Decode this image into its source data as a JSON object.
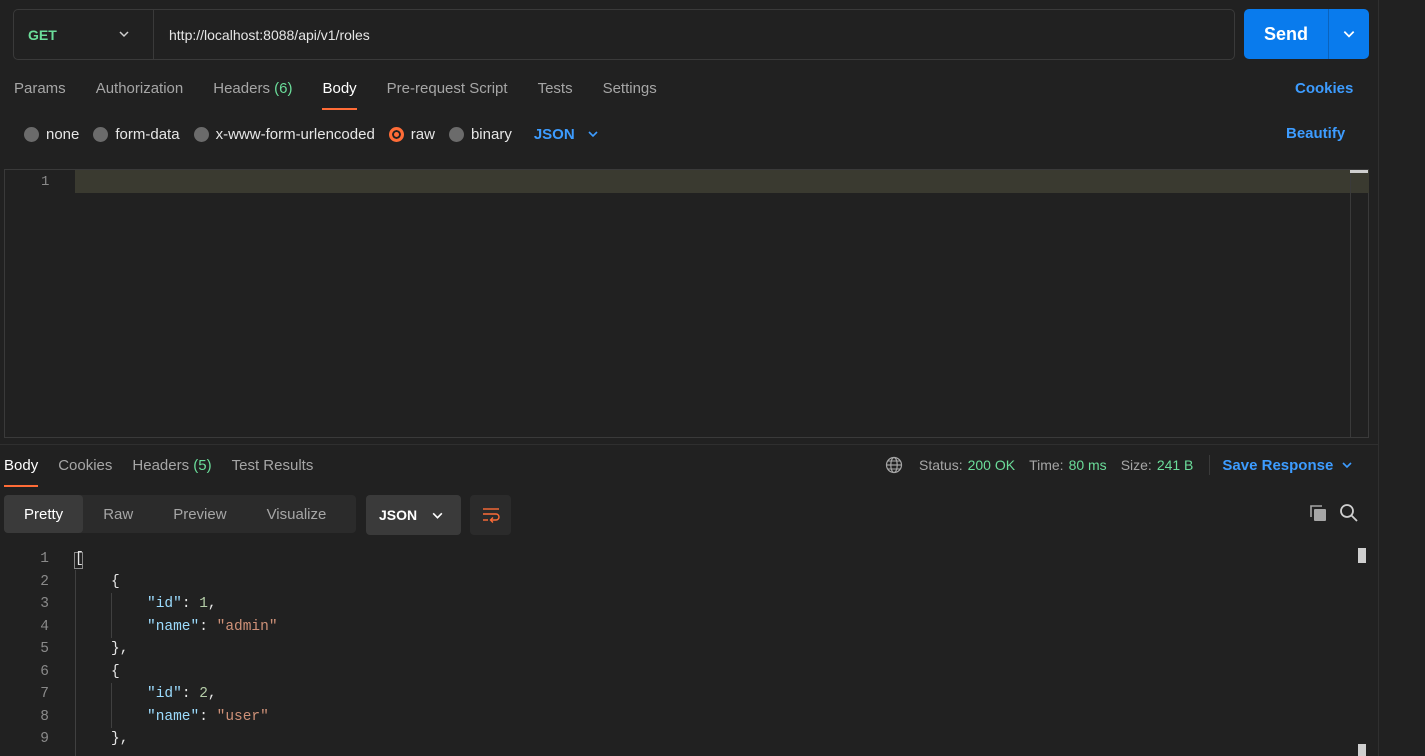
{
  "request": {
    "method": "GET",
    "url": "http://localhost:8088/api/v1/roles",
    "send_label": "Send"
  },
  "request_tabs": [
    {
      "label": "Params",
      "count": ""
    },
    {
      "label": "Authorization",
      "count": ""
    },
    {
      "label": "Headers",
      "count": "(6)"
    },
    {
      "label": "Body",
      "count": "",
      "active": true
    },
    {
      "label": "Pre-request Script",
      "count": ""
    },
    {
      "label": "Tests",
      "count": ""
    },
    {
      "label": "Settings",
      "count": ""
    }
  ],
  "cookies_label": "Cookies",
  "body_types": [
    {
      "label": "none",
      "checked": false
    },
    {
      "label": "form-data",
      "checked": false
    },
    {
      "label": "x-www-form-urlencoded",
      "checked": false
    },
    {
      "label": "raw",
      "checked": true
    },
    {
      "label": "binary",
      "checked": false
    }
  ],
  "body_format": "JSON",
  "beautify_label": "Beautify",
  "request_editor": {
    "line_numbers": [
      "1"
    ]
  },
  "response_tabs": [
    {
      "label": "Body",
      "count": "",
      "active": true
    },
    {
      "label": "Cookies",
      "count": ""
    },
    {
      "label": "Headers",
      "count": "(5)"
    },
    {
      "label": "Test Results",
      "count": ""
    }
  ],
  "response_meta": {
    "status_label": "Status:",
    "status_value": "200 OK",
    "time_label": "Time:",
    "time_value": "80 ms",
    "size_label": "Size:",
    "size_value": "241 B",
    "save_label": "Save Response"
  },
  "view_modes": [
    {
      "label": "Pretty",
      "active": true
    },
    {
      "label": "Raw"
    },
    {
      "label": "Preview"
    },
    {
      "label": "Visualize"
    }
  ],
  "response_format": "JSON",
  "response_lines": [
    {
      "n": "1",
      "indent": 0,
      "tokens": [
        {
          "t": "[",
          "c": "p"
        }
      ]
    },
    {
      "n": "2",
      "indent": 1,
      "tokens": [
        {
          "t": "{",
          "c": "p"
        }
      ]
    },
    {
      "n": "3",
      "indent": 2,
      "tokens": [
        {
          "t": "\"id\"",
          "c": "k"
        },
        {
          "t": ": ",
          "c": "p"
        },
        {
          "t": "1",
          "c": "n"
        },
        {
          "t": ",",
          "c": "p"
        }
      ]
    },
    {
      "n": "4",
      "indent": 2,
      "tokens": [
        {
          "t": "\"name\"",
          "c": "k"
        },
        {
          "t": ": ",
          "c": "p"
        },
        {
          "t": "\"admin\"",
          "c": "s"
        }
      ]
    },
    {
      "n": "5",
      "indent": 1,
      "tokens": [
        {
          "t": "},",
          "c": "p"
        }
      ]
    },
    {
      "n": "6",
      "indent": 1,
      "tokens": [
        {
          "t": "{",
          "c": "p"
        }
      ]
    },
    {
      "n": "7",
      "indent": 2,
      "tokens": [
        {
          "t": "\"id\"",
          "c": "k"
        },
        {
          "t": ": ",
          "c": "p"
        },
        {
          "t": "2",
          "c": "n"
        },
        {
          "t": ",",
          "c": "p"
        }
      ]
    },
    {
      "n": "8",
      "indent": 2,
      "tokens": [
        {
          "t": "\"name\"",
          "c": "k"
        },
        {
          "t": ": ",
          "c": "p"
        },
        {
          "t": "\"user\"",
          "c": "s"
        }
      ]
    },
    {
      "n": "9",
      "indent": 1,
      "tokens": [
        {
          "t": "},",
          "c": "p"
        }
      ]
    }
  ],
  "colors": {
    "accent_orange": "#ff6c37",
    "link_blue": "#3d9cff",
    "send_blue": "#097bed",
    "success_green": "#6bdd9a"
  },
  "icons": {
    "method_chevron": "chevron-down-icon",
    "send_chevron": "chevron-down-icon",
    "format_chevron": "chevron-down-icon",
    "globe": "globe-icon",
    "save_chevron": "chevron-down-icon",
    "wrap": "wrap-lines-icon",
    "copy": "copy-icon",
    "search": "search-icon"
  }
}
